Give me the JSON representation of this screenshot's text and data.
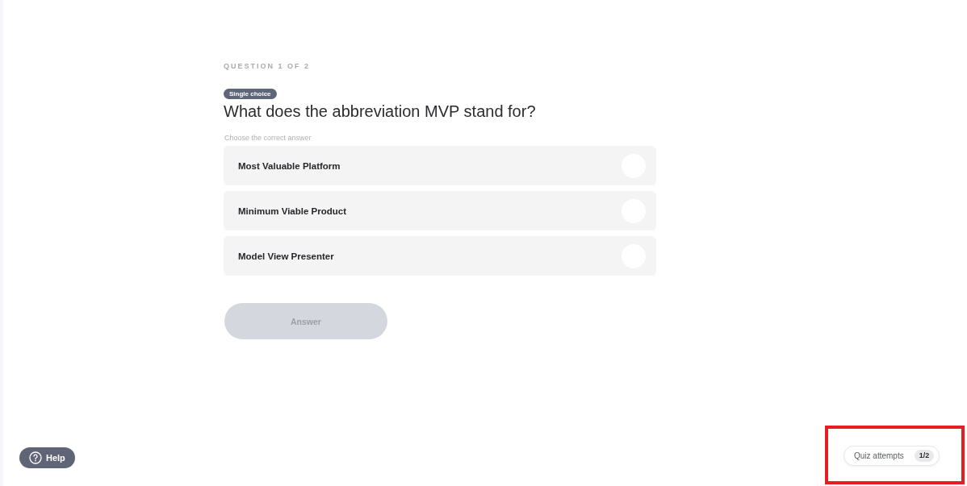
{
  "header": {
    "progress": "QUESTION 1 OF 2"
  },
  "question": {
    "type_badge": "Single choice",
    "title": "What does the abbreviation MVP stand for?",
    "instruction": "Choose the correct answer"
  },
  "options": [
    {
      "label": "Most Valuable Platform",
      "selected": false
    },
    {
      "label": "Minimum Viable Product",
      "selected": false
    },
    {
      "label": "Model View Presenter",
      "selected": false
    }
  ],
  "answer_button": {
    "label": "Answer",
    "disabled": true
  },
  "help_button": {
    "label": "Help"
  },
  "attempts": {
    "label": "Quiz attempts",
    "count": "1/2",
    "highlighted": true
  }
}
